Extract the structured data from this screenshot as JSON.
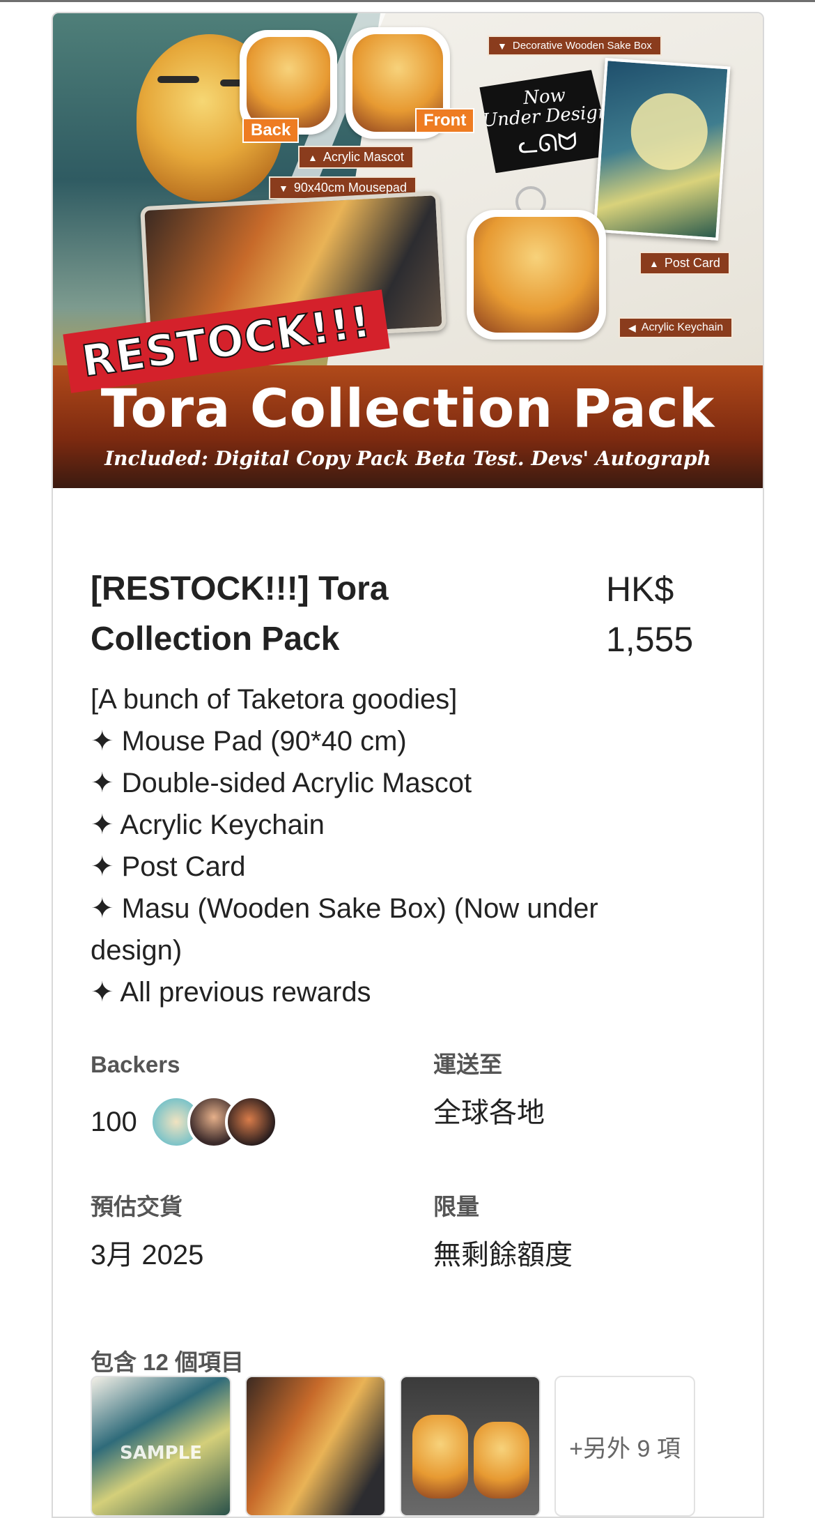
{
  "banner": {
    "tags": {
      "decorative_box": "Decorative Wooden Sake Box",
      "acrylic_mascot": "Acrylic Mascot",
      "mousepad": "90x40cm Mousepad",
      "post_card": "Post Card",
      "acrylic_keychain": "Acrylic Keychain"
    },
    "labels": {
      "back": "Back",
      "front": "Front",
      "now": "Now",
      "under_design": "Under Design"
    },
    "restock": "RESTOCK!!!",
    "title": "Tora Collection Pack",
    "subtitle": "Included: Digital Copy Pack  Beta Test.  Devs' Autograph",
    "accent": "#8a3c1d"
  },
  "reward": {
    "title": "[RESTOCK!!!] Tora Collection Pack",
    "price_currency": "HK$",
    "price_amount": "1,555",
    "description": [
      "[A bunch of Taketora goodies]",
      "✦ Mouse Pad (90*40 cm)",
      "✦ Double-sided Acrylic Mascot",
      "✦ Acrylic Keychain",
      "✦ Post Card",
      "✦ Masu (Wooden Sake Box) (Now under design)",
      "✦ All previous rewards"
    ]
  },
  "info": {
    "backers_label": "Backers",
    "backers_count": "100",
    "shipping_label": "運送至",
    "shipping_value": "全球各地",
    "delivery_label": "預估交貨",
    "delivery_value": "3月 2025",
    "limit_label": "限量",
    "limit_value": "無剩餘額度"
  },
  "items": {
    "label": "包含 12 個項目",
    "sample_text": "SAMPLE",
    "more_text": "+另外 9 項"
  }
}
